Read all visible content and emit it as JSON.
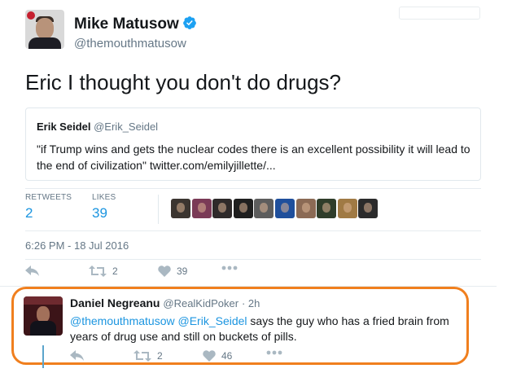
{
  "main_tweet": {
    "author_name": "Mike Matusow",
    "author_handle": "@themouthmatusow",
    "text": "Eric I thought you don't do drugs?",
    "quoted": {
      "name": "Erik Seidel",
      "handle": "@Erik_Seidel",
      "text": "\"if Trump wins and gets the nuclear codes there is an excellent possibility it will lead to the end of civilization\" twitter.com/emilyjillette/..."
    },
    "stats": {
      "retweets_label": "RETWEETS",
      "retweets_value": "2",
      "likes_label": "LIKES",
      "likes_value": "39"
    },
    "likers": [
      "#3b3530",
      "#7a3a56",
      "#2e2a2a",
      "#1f1f1f",
      "#5d5d5d",
      "#1f4f9c",
      "#8b6a55",
      "#2f3d2a",
      "#a07a44",
      "#2b2b2b"
    ],
    "timestamp": "6:26 PM - 18 Jul 2016",
    "actions": {
      "retweet_count": "2",
      "like_count": "39"
    }
  },
  "reply_tweet": {
    "author_name": "Daniel Negreanu",
    "author_handle": "@RealKidPoker",
    "time": "· 2h",
    "mention_1": "@themouthmatusow",
    "mention_2": "@Erik_Seidel",
    "text": " says the guy who has a fried brain from years of drug use and still on buckets of pills.",
    "actions": {
      "retweet_count": "2",
      "like_count": "46"
    }
  },
  "colors": {
    "accent": "#1b95e0",
    "highlight_outline": "#f07f1e",
    "verified": "#1da1f2"
  }
}
